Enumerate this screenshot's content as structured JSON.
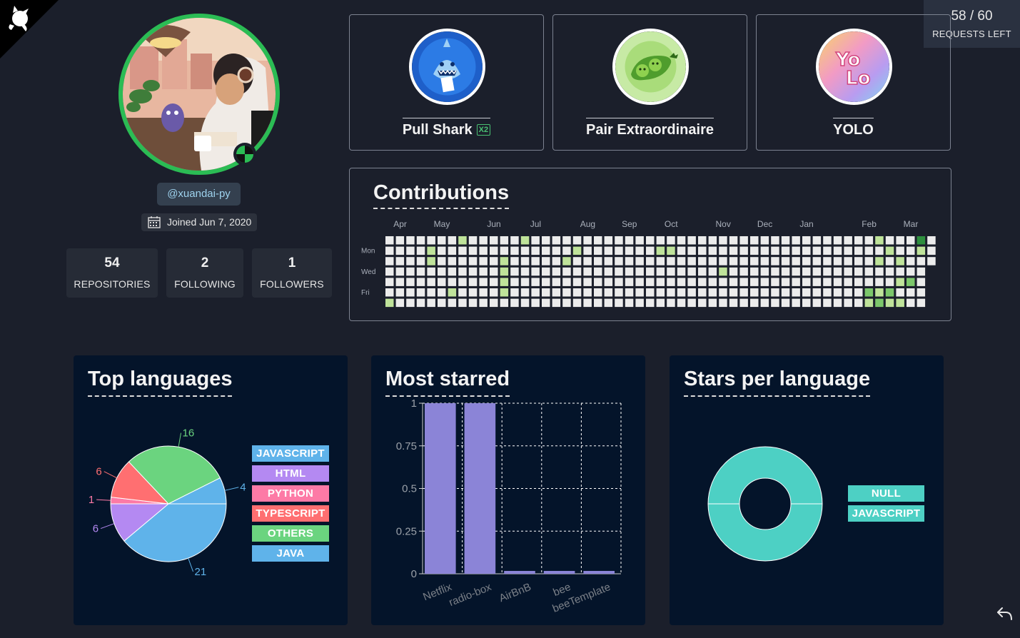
{
  "rate_limit": {
    "count": "58 / 60",
    "label": "REQUESTS LEFT"
  },
  "profile": {
    "handle": "@xuandai-py",
    "joined": "Joined Jun 7, 2020",
    "stats": [
      {
        "value": "54",
        "label": "REPOSITORIES"
      },
      {
        "value": "2",
        "label": "FOLLOWING"
      },
      {
        "value": "1",
        "label": "FOLLOWERS"
      }
    ]
  },
  "badges": [
    {
      "name": "Pull Shark",
      "multiplier": "X2",
      "icon": "shark-icon",
      "color": "#2b6fd6"
    },
    {
      "name": "Pair Extraordinaire",
      "multiplier": "",
      "icon": "peas-icon",
      "color": "#8fcf56"
    },
    {
      "name": "YOLO",
      "multiplier": "",
      "icon": "yolo-icon",
      "color": "#f3a2c4"
    }
  ],
  "contributions": {
    "title": "Contributions",
    "months": [
      "Apr",
      "May",
      "Jun",
      "Jul",
      "Aug",
      "Sep",
      "Oct",
      "Nov",
      "Dec",
      "Jan",
      "Feb",
      "Mar"
    ],
    "days": [
      "Mon",
      "Wed",
      "Fri"
    ],
    "level_colors": [
      "#ececec",
      "#bfe39a",
      "#7cc76b",
      "#2e8f3e"
    ],
    "active_cells": [
      [
        0,
        6,
        1
      ],
      [
        4,
        1,
        1
      ],
      [
        4,
        2,
        1
      ],
      [
        6,
        5,
        1
      ],
      [
        7,
        0,
        1
      ],
      [
        11,
        3,
        1
      ],
      [
        11,
        2,
        1
      ],
      [
        11,
        4,
        1
      ],
      [
        11,
        5,
        1
      ],
      [
        13,
        0,
        1
      ],
      [
        17,
        2,
        1
      ],
      [
        18,
        1,
        1
      ],
      [
        26,
        1,
        1
      ],
      [
        27,
        1,
        1
      ],
      [
        32,
        3,
        1
      ],
      [
        46,
        5,
        2
      ],
      [
        46,
        6,
        1
      ],
      [
        47,
        0,
        1
      ],
      [
        47,
        2,
        1
      ],
      [
        47,
        5,
        1
      ],
      [
        47,
        6,
        2
      ],
      [
        48,
        1,
        1
      ],
      [
        48,
        5,
        2
      ],
      [
        48,
        6,
        1
      ],
      [
        49,
        2,
        1
      ],
      [
        49,
        4,
        1
      ],
      [
        49,
        6,
        1
      ],
      [
        50,
        4,
        2
      ],
      [
        51,
        0,
        3
      ],
      [
        51,
        1,
        1
      ]
    ]
  },
  "top_languages": {
    "title": "Top languages",
    "legend": [
      "JAVASCRIPT",
      "HTML",
      "PYTHON",
      "TYPESCRIPT",
      "OTHERS",
      "JAVA"
    ],
    "colors": {
      "JAVASCRIPT": "#5fb3ea",
      "HTML": "#b489f2",
      "PYTHON": "#fd7aa6",
      "TYPESCRIPT": "#ff6f71",
      "OTHERS": "#6bd47f",
      "JAVA": "#5fb3ea"
    }
  },
  "most_starred": {
    "title": "Most starred"
  },
  "stars_per_language": {
    "title": "Stars per language",
    "legend": [
      "NULL",
      "JAVASCRIPT"
    ],
    "color": "#4dd0c4"
  },
  "chart_data": [
    {
      "type": "pie",
      "title": "Top languages",
      "categories": [
        "JAVASCRIPT",
        "HTML",
        "PYTHON",
        "TYPESCRIPT",
        "OTHERS",
        "JAVA"
      ],
      "values": [
        21,
        6,
        1,
        6,
        16,
        4
      ],
      "legend_position": "right"
    },
    {
      "type": "bar",
      "title": "Most starred",
      "categories": [
        "Netflix",
        "radio-box",
        "AirBnB",
        "bee",
        "beeTemplate"
      ],
      "values": [
        1,
        1,
        0,
        0,
        0
      ],
      "ylim": [
        0,
        1
      ],
      "yticks": [
        0,
        0.25,
        0.5,
        0.75,
        1
      ],
      "grid": true,
      "color": "#8b84d7"
    },
    {
      "type": "pie",
      "title": "Stars per language",
      "categories": [
        "NULL",
        "JAVASCRIPT"
      ],
      "values": [
        1,
        1
      ],
      "donut": true,
      "legend_position": "right"
    }
  ]
}
